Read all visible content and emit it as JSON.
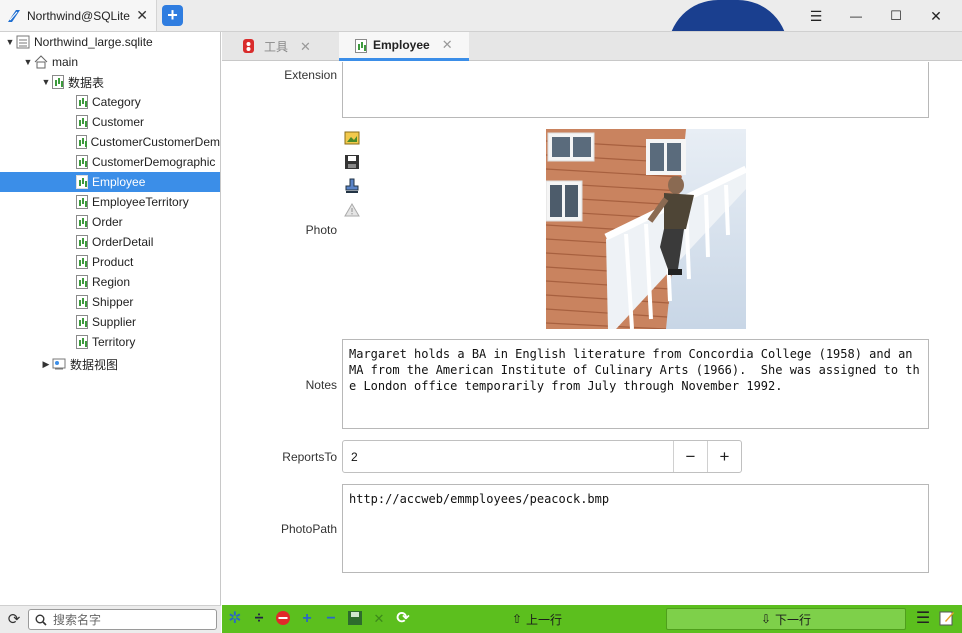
{
  "window": {
    "tab_title": "Northwind@SQLite",
    "close": "✕",
    "new_tab": "+",
    "controls": {
      "menu": "☰",
      "minimize": "—",
      "maximize": "☐",
      "close": "✕"
    }
  },
  "tree": {
    "root": "Northwind_large.sqlite",
    "schema": "main",
    "tables_folder": "数据表",
    "tables": [
      "Category",
      "Customer",
      "CustomerCustomerDem",
      "CustomerDemographic",
      "Employee",
      "EmployeeTerritory",
      "Order",
      "OrderDetail",
      "Product",
      "Region",
      "Shipper",
      "Supplier",
      "Territory"
    ],
    "selected_table": "Employee",
    "views_folder": "数据视图"
  },
  "search": {
    "placeholder": "搜索名字"
  },
  "doc_tabs": [
    {
      "label": "工具",
      "active": false
    },
    {
      "label": "Employee",
      "active": true
    }
  ],
  "form": {
    "extension": {
      "label": "Extension",
      "value": ""
    },
    "photo": {
      "label": "Photo",
      "tools": [
        "load-icon",
        "save-icon",
        "clear-icon",
        "warning-icon"
      ]
    },
    "notes": {
      "label": "Notes",
      "value": "Margaret holds a BA in English literature from Concordia College (1958) and an MA from the American Institute of Culinary Arts (1966).  She was assigned to the London office temporarily from July through November 1992."
    },
    "reports_to": {
      "label": "ReportsTo",
      "value": "2",
      "decrement": "−",
      "increment": "+"
    },
    "photo_path": {
      "label": "PhotoPath",
      "value": "http://accweb/emmployees/peacock.bmp"
    }
  },
  "bottom_bar": {
    "prev_label": "上一行",
    "next_label": "下一行"
  },
  "colors": {
    "accent": "#3b8ee8",
    "toolbar_green": "#5cbf1e",
    "new_tab_blue": "#2f7de0"
  }
}
